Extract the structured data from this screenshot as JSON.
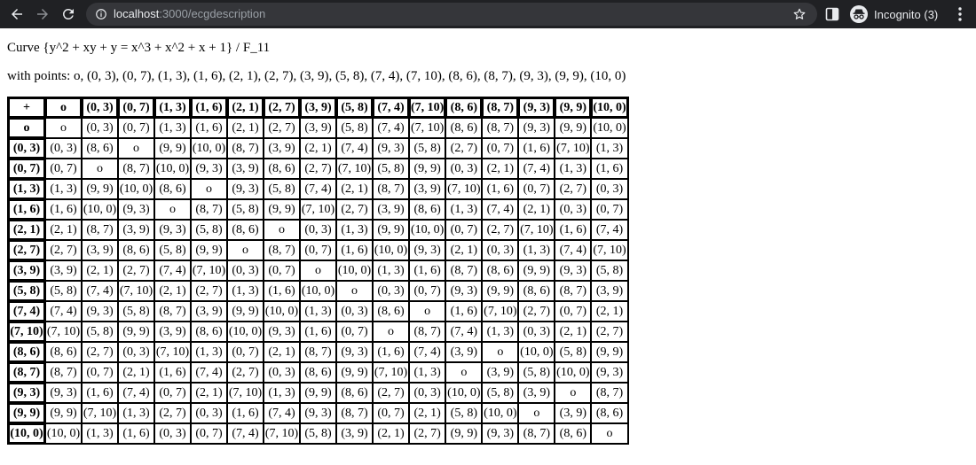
{
  "browser": {
    "url_host": "localhost",
    "url_path": ":3000/ecgdescription",
    "incognito_label": "Incognito (3)",
    "icons": [
      "back-icon",
      "forward-icon",
      "reload-icon",
      "info-icon",
      "star-icon",
      "side-panel-icon",
      "incognito-icon",
      "menu-icon"
    ]
  },
  "page": {
    "curve_text": "Curve {y^2 + xy + y = x^3 + x^2 + x + 1} / F_11",
    "points_text": "with points: o, (0, 3), (0, 7), (1, 3), (1, 6), (2, 1), (2, 7), (3, 9), (5, 8), (7, 4), (7, 10), (8, 6), (8, 7), (9, 3), (9, 9), (10, 0)"
  },
  "table": {
    "corner": "+",
    "headers": [
      "o",
      "(0, 3)",
      "(0, 7)",
      "(1, 3)",
      "(1, 6)",
      "(2, 1)",
      "(2, 7)",
      "(3, 9)",
      "(5, 8)",
      "(7, 4)",
      "(7, 10)",
      "(8, 6)",
      "(8, 7)",
      "(9, 3)",
      "(9, 9)",
      "(10, 0)"
    ],
    "rows": [
      [
        "o",
        "(0, 3)",
        "(0, 7)",
        "(1, 3)",
        "(1, 6)",
        "(2, 1)",
        "(2, 7)",
        "(3, 9)",
        "(5, 8)",
        "(7, 4)",
        "(7, 10)",
        "(8, 6)",
        "(8, 7)",
        "(9, 3)",
        "(9, 9)",
        "(10, 0)"
      ],
      [
        "(0, 3)",
        "(8, 6)",
        "o",
        "(9, 9)",
        "(10, 0)",
        "(8, 7)",
        "(3, 9)",
        "(2, 1)",
        "(7, 4)",
        "(9, 3)",
        "(5, 8)",
        "(2, 7)",
        "(0, 7)",
        "(1, 6)",
        "(7, 10)",
        "(1, 3)"
      ],
      [
        "(0, 7)",
        "o",
        "(8, 7)",
        "(10, 0)",
        "(9, 3)",
        "(3, 9)",
        "(8, 6)",
        "(2, 7)",
        "(7, 10)",
        "(5, 8)",
        "(9, 9)",
        "(0, 3)",
        "(2, 1)",
        "(7, 4)",
        "(1, 3)",
        "(1, 6)"
      ],
      [
        "(1, 3)",
        "(9, 9)",
        "(10, 0)",
        "(8, 6)",
        "o",
        "(9, 3)",
        "(5, 8)",
        "(7, 4)",
        "(2, 1)",
        "(8, 7)",
        "(3, 9)",
        "(7, 10)",
        "(1, 6)",
        "(0, 7)",
        "(2, 7)",
        "(0, 3)"
      ],
      [
        "(1, 6)",
        "(10, 0)",
        "(9, 3)",
        "o",
        "(8, 7)",
        "(5, 8)",
        "(9, 9)",
        "(7, 10)",
        "(2, 7)",
        "(3, 9)",
        "(8, 6)",
        "(1, 3)",
        "(7, 4)",
        "(2, 1)",
        "(0, 3)",
        "(0, 7)"
      ],
      [
        "(2, 1)",
        "(8, 7)",
        "(3, 9)",
        "(9, 3)",
        "(5, 8)",
        "(8, 6)",
        "o",
        "(0, 3)",
        "(1, 3)",
        "(9, 9)",
        "(10, 0)",
        "(0, 7)",
        "(2, 7)",
        "(7, 10)",
        "(1, 6)",
        "(7, 4)"
      ],
      [
        "(2, 7)",
        "(3, 9)",
        "(8, 6)",
        "(5, 8)",
        "(9, 9)",
        "o",
        "(8, 7)",
        "(0, 7)",
        "(1, 6)",
        "(10, 0)",
        "(9, 3)",
        "(2, 1)",
        "(0, 3)",
        "(1, 3)",
        "(7, 4)",
        "(7, 10)"
      ],
      [
        "(3, 9)",
        "(2, 1)",
        "(2, 7)",
        "(7, 4)",
        "(7, 10)",
        "(0, 3)",
        "(0, 7)",
        "o",
        "(10, 0)",
        "(1, 3)",
        "(1, 6)",
        "(8, 7)",
        "(8, 6)",
        "(9, 9)",
        "(9, 3)",
        "(5, 8)"
      ],
      [
        "(5, 8)",
        "(7, 4)",
        "(7, 10)",
        "(2, 1)",
        "(2, 7)",
        "(1, 3)",
        "(1, 6)",
        "(10, 0)",
        "o",
        "(0, 3)",
        "(0, 7)",
        "(9, 3)",
        "(9, 9)",
        "(8, 6)",
        "(8, 7)",
        "(3, 9)"
      ],
      [
        "(7, 4)",
        "(9, 3)",
        "(5, 8)",
        "(8, 7)",
        "(3, 9)",
        "(9, 9)",
        "(10, 0)",
        "(1, 3)",
        "(0, 3)",
        "(8, 6)",
        "o",
        "(1, 6)",
        "(7, 10)",
        "(2, 7)",
        "(0, 7)",
        "(2, 1)"
      ],
      [
        "(7, 10)",
        "(5, 8)",
        "(9, 9)",
        "(3, 9)",
        "(8, 6)",
        "(10, 0)",
        "(9, 3)",
        "(1, 6)",
        "(0, 7)",
        "o",
        "(8, 7)",
        "(7, 4)",
        "(1, 3)",
        "(0, 3)",
        "(2, 1)",
        "(2, 7)"
      ],
      [
        "(8, 6)",
        "(2, 7)",
        "(0, 3)",
        "(7, 10)",
        "(1, 3)",
        "(0, 7)",
        "(2, 1)",
        "(8, 7)",
        "(9, 3)",
        "(1, 6)",
        "(7, 4)",
        "(3, 9)",
        "o",
        "(10, 0)",
        "(5, 8)",
        "(9, 9)"
      ],
      [
        "(8, 7)",
        "(0, 7)",
        "(2, 1)",
        "(1, 6)",
        "(7, 4)",
        "(2, 7)",
        "(0, 3)",
        "(8, 6)",
        "(9, 9)",
        "(7, 10)",
        "(1, 3)",
        "o",
        "(3, 9)",
        "(5, 8)",
        "(10, 0)",
        "(9, 3)"
      ],
      [
        "(9, 3)",
        "(1, 6)",
        "(7, 4)",
        "(0, 7)",
        "(2, 1)",
        "(7, 10)",
        "(1, 3)",
        "(9, 9)",
        "(8, 6)",
        "(2, 7)",
        "(0, 3)",
        "(10, 0)",
        "(5, 8)",
        "(3, 9)",
        "o",
        "(8, 7)"
      ],
      [
        "(9, 9)",
        "(7, 10)",
        "(1, 3)",
        "(2, 7)",
        "(0, 3)",
        "(1, 6)",
        "(7, 4)",
        "(9, 3)",
        "(8, 7)",
        "(0, 7)",
        "(2, 1)",
        "(5, 8)",
        "(10, 0)",
        "o",
        "(3, 9)",
        "(8, 6)"
      ],
      [
        "(10, 0)",
        "(1, 3)",
        "(1, 6)",
        "(0, 3)",
        "(0, 7)",
        "(7, 4)",
        "(7, 10)",
        "(5, 8)",
        "(3, 9)",
        "(2, 1)",
        "(2, 7)",
        "(9, 9)",
        "(9, 3)",
        "(8, 7)",
        "(8, 6)",
        "o"
      ]
    ]
  }
}
